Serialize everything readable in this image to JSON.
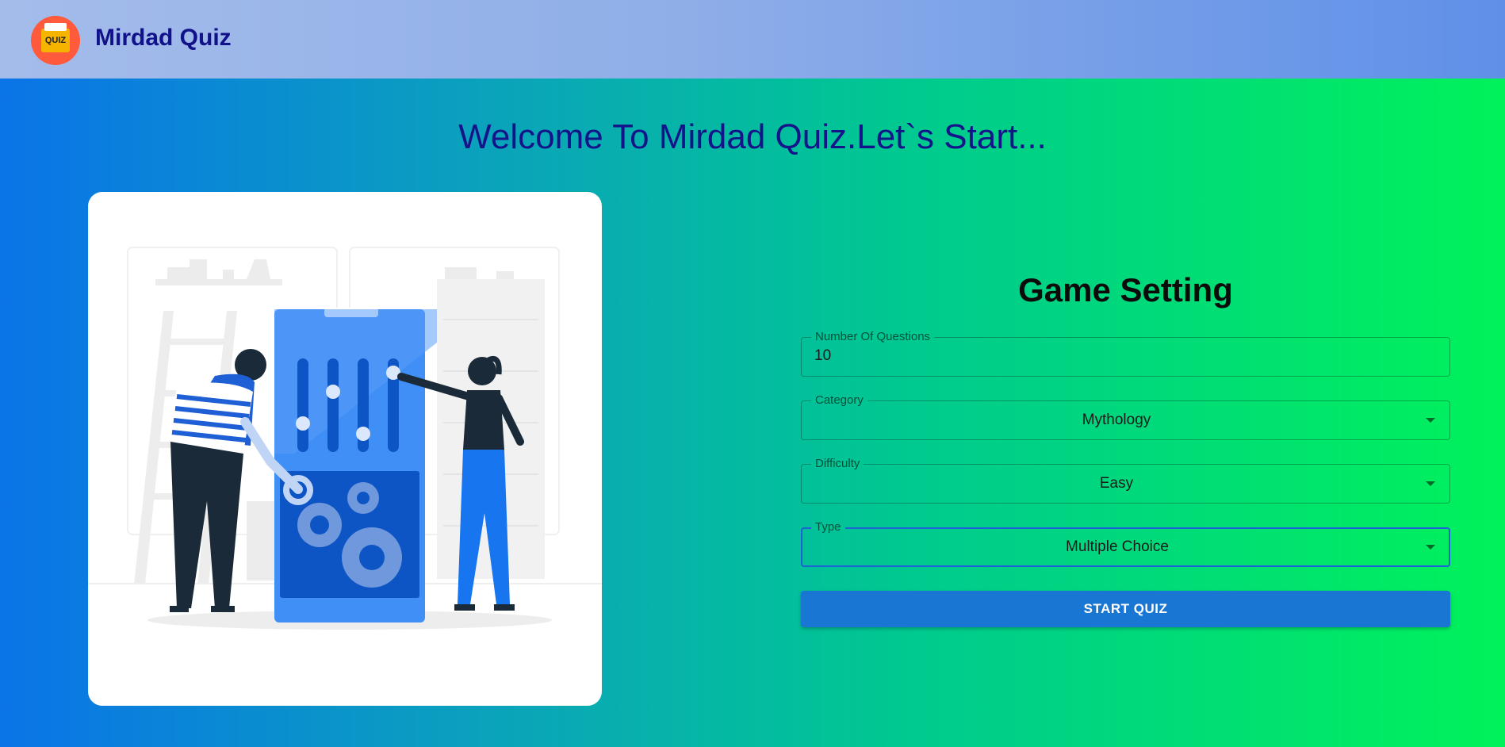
{
  "app": {
    "logo_text": "QUIZ",
    "title": "Mirdad Quiz"
  },
  "welcome": "Welcome To Mirdad Quiz.Let`s Start...",
  "settings": {
    "title": "Game Setting",
    "number_of_questions": {
      "label": "Number Of Questions",
      "value": "10"
    },
    "category": {
      "label": "Category",
      "value": "Mythology"
    },
    "difficulty": {
      "label": "Difficulty",
      "value": "Easy"
    },
    "type": {
      "label": "Type",
      "value": "Multiple Choice"
    },
    "start_button": "START QUIZ"
  },
  "colors": {
    "appbar_gradient_start": "#a4bcea",
    "appbar_gradient_end": "#5f90e8",
    "title_color": "#11118a",
    "button": "#1976d2",
    "focus_border": "#1e63d6",
    "logo_circle": "#ff5a3c"
  },
  "icons": {
    "logo": "quiz-folder-icon",
    "select_caret": "caret-down-icon"
  }
}
